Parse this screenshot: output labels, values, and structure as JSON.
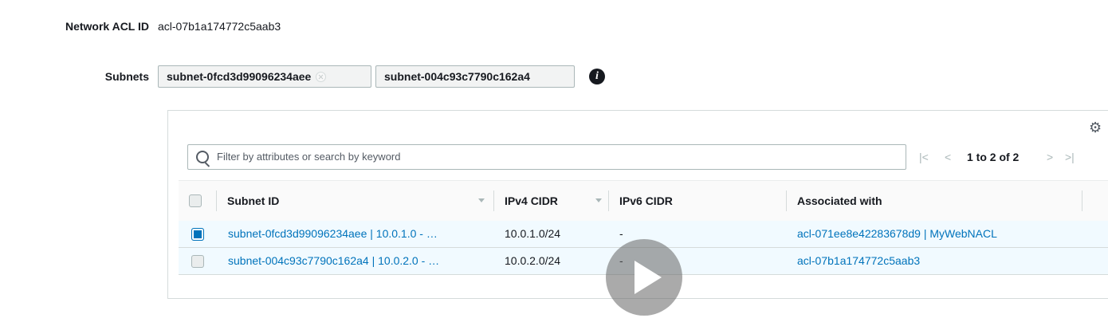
{
  "acl": {
    "label": "Network ACL ID",
    "value": "acl-07b1a174772c5aab3"
  },
  "subnets": {
    "label": "Subnets",
    "tokens": [
      "subnet-0fcd3d99096234aee",
      "subnet-004c93c7790c162a4"
    ]
  },
  "table": {
    "filter_placeholder": "Filter by attributes or search by keyword",
    "pagination": "1 to 2 of 2",
    "columns": [
      "Subnet ID",
      "IPv4 CIDR",
      "IPv6 CIDR",
      "Associated with"
    ],
    "rows": [
      {
        "subnet": "subnet-0fcd3d99096234aee | 10.0.1.0 - …",
        "ipv4": "10.0.1.0/24",
        "ipv6": "-",
        "associated": "acl-071ee8e42283678d9 | MyWebNACL",
        "checked": true
      },
      {
        "subnet": "subnet-004c93c7790c162a4 | 10.0.2.0 - …",
        "ipv4": "10.0.2.0/24",
        "ipv6": "-",
        "associated": "acl-07b1a174772c5aab3",
        "checked": false
      }
    ]
  },
  "icons": [
    "info-icon",
    "gear-icon",
    "search-icon",
    "first-page-icon",
    "prev-page-icon",
    "next-page-icon",
    "last-page-icon",
    "play-icon"
  ],
  "colors": {
    "link": "#0073bb",
    "row_bg": "#f1faff",
    "checkbox_checked": "#0073bb"
  }
}
